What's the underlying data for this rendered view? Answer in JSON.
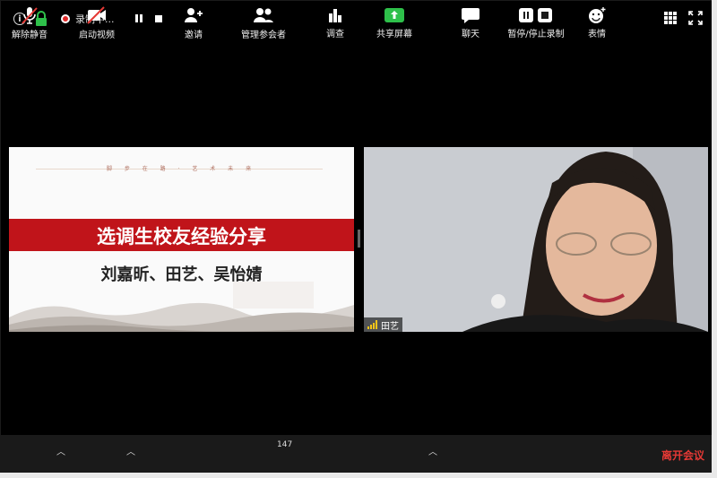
{
  "topbar": {
    "recording_label": "录制中..."
  },
  "slide": {
    "header_text": "脚 步 在 路 · 艺 术 未 来",
    "title": "选调生校友经验分享",
    "names": "刘嘉昕、田艺、吴怡婧"
  },
  "video": {
    "participant_name": "田艺"
  },
  "toolbar": {
    "unmute": "解除静音",
    "start_video": "启动视频",
    "invite": "邀请",
    "manage_participants": "管理参会者",
    "participant_count": "147",
    "polls": "调查",
    "share_screen": "共享屏幕",
    "chat": "聊天",
    "pause_stop_recording": "暂停/停止录制",
    "reactions": "表情",
    "leave": "离开会议"
  },
  "colors": {
    "accent_red": "#c0141a",
    "leave_red": "#e53935",
    "share_green": "#2ec04a",
    "signal_yellow": "#f5c518"
  }
}
